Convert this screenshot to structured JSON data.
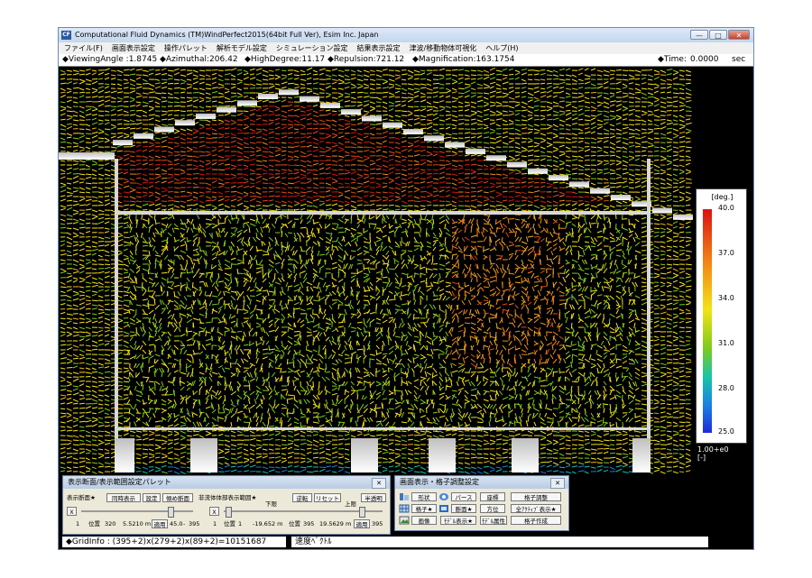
{
  "window": {
    "title": "Computational Fluid Dynamics (TM)WindPerfect2015(64bit Full Ver), Esim Inc. Japan",
    "icon_text": "CF",
    "minimize_glyph": "—",
    "maximize_glyph": "□",
    "close_glyph": "✕"
  },
  "menu": [
    "ファイル(F)",
    "画面表示設定",
    "操作パレット",
    "解析モデル設定",
    "シミュレーション設定",
    "結果表示設定",
    "津波/移動物体可視化",
    "ヘルプ(H)"
  ],
  "info": {
    "viewing_angle": "◆ViewingAngle :1.8745",
    "azimuthal": "◆Azimuthal:206.42",
    "high_degree": "◆HighDegree:11.17",
    "repulsion": "◆Repulsion:721.12",
    "magnification": "◆Magnification:163.1754",
    "time_label": "◆Time:",
    "time_value": "0.0000",
    "time_unit": "sec"
  },
  "color_scale": {
    "unit": "[deg.]",
    "ticks": [
      "40.0",
      "37.0",
      "34.0",
      "31.0",
      "28.0",
      "25.0"
    ],
    "colors": [
      "#dd1111",
      "#f28b16",
      "#f3e317",
      "#7ecb1c",
      "#18c4a8",
      "#1a7fe5",
      "#1d2bd8"
    ]
  },
  "vector_legend": {
    "value": "1.00+e0",
    "unit": "[-]"
  },
  "palette_left": {
    "title": "表示断面/表示範囲設定パレット",
    "row1": {
      "label": "表示断面★",
      "btn1": "同時表示",
      "btn2": "設定",
      "btn3": "傾め断面",
      "label2": "非流体体部表示範囲★",
      "lower": "下限",
      "btn4": "逆転",
      "btn5": "リセット",
      "upper": "上限",
      "btn6": "半透明"
    },
    "x_button": "X",
    "x_button2": "X",
    "row3": {
      "n1": "1",
      "pos_label": "位置",
      "pos": "320",
      "coord": "5.5210 m",
      "apply": "適用",
      "angle": "45.0",
      "max1": "395",
      "n2": "1",
      "pos_label2": "位置",
      "pos2": "1",
      "coord2": "-19.652 m",
      "pos_label3": "位置",
      "pos3": "395",
      "coord3": "19.5629 m",
      "apply2": "適用",
      "max2": "395"
    }
  },
  "palette_right": {
    "title": "画面表示・格子調整設定",
    "buttons": [
      "形状",
      "パース",
      "座標",
      "格子調整",
      "格子★",
      "断面★",
      "方位",
      "全ｱｸﾃｨﾌﾞ表示★",
      "画像",
      "ﾓﾃﾞﾙ表示★",
      "ﾓﾃﾞﾙ属性",
      "格子作成"
    ]
  },
  "status": {
    "gridinfo": "◆GridInfo : (395+2)x(279+2)x(89+2)=10151687",
    "mode": "速度ﾍﾞｸﾄﾙ"
  }
}
